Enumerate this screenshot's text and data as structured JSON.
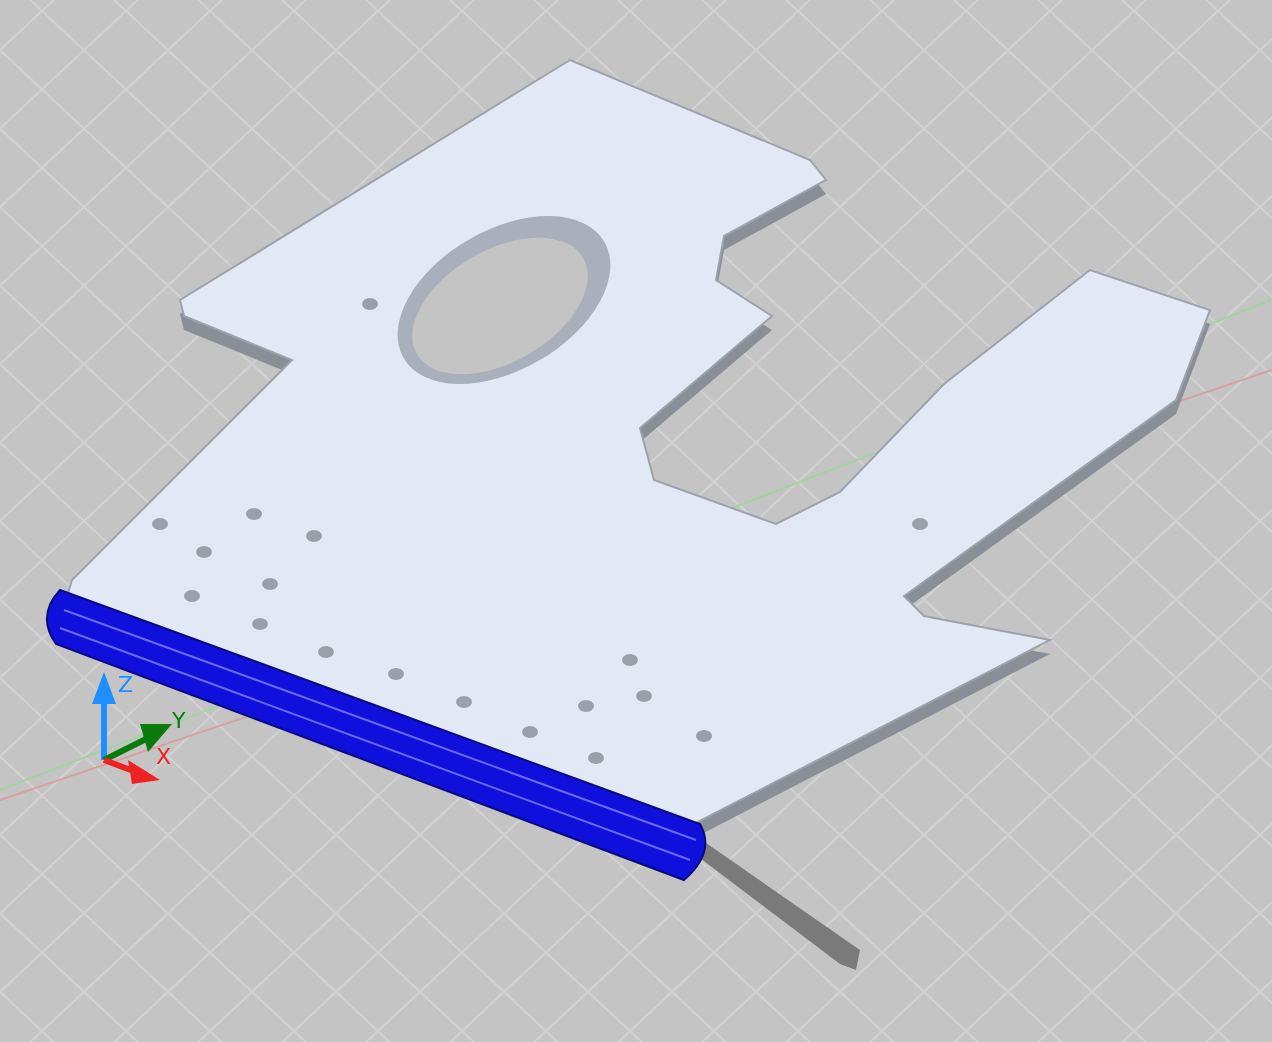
{
  "viewport": {
    "axes": [
      {
        "kind": "z",
        "label": "Z",
        "color": "#1e8fff"
      },
      {
        "kind": "y",
        "label": "Y",
        "color": "#0a7a0a"
      },
      {
        "kind": "x",
        "label": "X",
        "color": "#ee2222"
      }
    ]
  }
}
